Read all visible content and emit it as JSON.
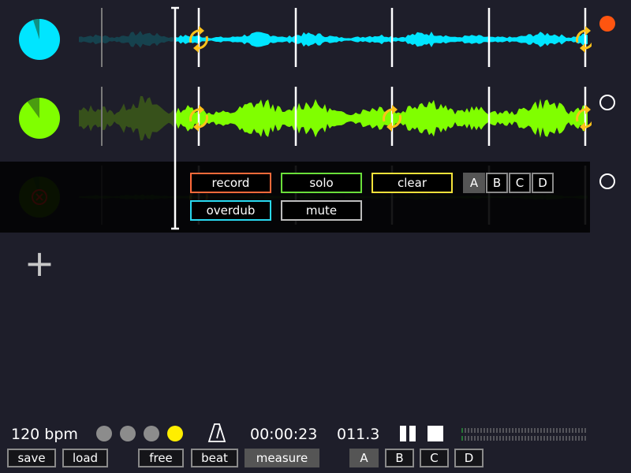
{
  "colors": {
    "background": "#1e1e2a",
    "track1": "#00e5ff",
    "track2": "#80ff00",
    "track3": "#3a7a00",
    "loop_marker": "#ffc21a",
    "record_active": "#ff5510",
    "metronome_active": "#ffee00",
    "metronome_idle": "#8c8c8c",
    "record_border": "#ff6a3a",
    "solo_border": "#6adf3a",
    "clear_border": "#f5e23a",
    "overdub_border": "#29d9f0",
    "mute_border": "#bdbdbd"
  },
  "tracks": [
    {
      "name": "track-1",
      "color": "#00e5ff",
      "pie_fraction": 0.95,
      "record_armed": true
    },
    {
      "name": "track-2",
      "color": "#80ff00",
      "pie_fraction": 0.9,
      "record_armed": false
    },
    {
      "name": "track-3",
      "color": "#3a7a00",
      "pie_fraction": 0.95,
      "record_armed": false,
      "muted_icon": "close-circle-icon"
    }
  ],
  "track_menu": {
    "record": "record",
    "solo": "solo",
    "clear": "clear",
    "overdub": "overdub",
    "mute": "mute",
    "scenes": [
      "A",
      "B",
      "C",
      "D"
    ],
    "active_scene": "A"
  },
  "add_track_icon": "+",
  "bottom_bar": {
    "bpm": "120 bpm",
    "beats": 4,
    "current_beat": 4,
    "metronome_icon": "metronome-icon",
    "time": "00:00:23",
    "measure": "011.3",
    "pause_icon": "pause-icon",
    "stop_icon": "stop-icon",
    "save": "save",
    "load": "load",
    "modes": [
      "free",
      "beat",
      "measure"
    ],
    "active_mode": "measure",
    "scenes": [
      "A",
      "B",
      "C",
      "D"
    ],
    "active_scene": "A"
  }
}
